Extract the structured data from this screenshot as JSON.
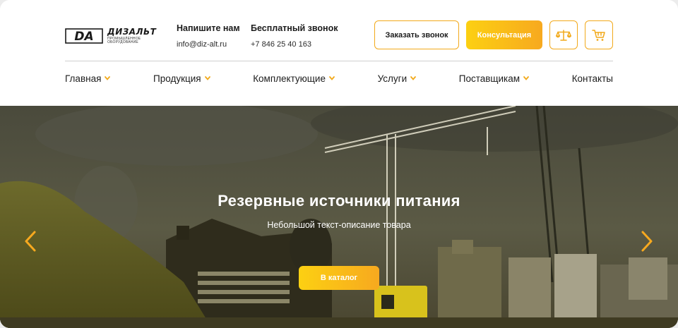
{
  "logo": {
    "mark": "DA",
    "name": "ДИЗАЛЬТ",
    "subtitle": "ПРОМЫШЛЕННОЕ ОБОРУДОВАНИЕ"
  },
  "contacts": {
    "email": {
      "title": "Напишите нам",
      "value": "info@diz-alt.ru"
    },
    "phone": {
      "title": "Бесплатный звонок",
      "value": "+7 846 25 40 163"
    }
  },
  "actions": {
    "callback_label": "Заказать звонок",
    "consult_label": "Консультация",
    "compare_icon": "scales-icon",
    "cart_icon": "cart-icon"
  },
  "nav": [
    {
      "label": "Главная",
      "dropdown": true
    },
    {
      "label": "Продукция",
      "dropdown": true
    },
    {
      "label": "Комплектующие",
      "dropdown": true
    },
    {
      "label": "Услуги",
      "dropdown": true
    },
    {
      "label": "Поставщикам",
      "dropdown": true
    },
    {
      "label": "Контакты",
      "dropdown": false
    }
  ],
  "hero": {
    "title": "Резервные источники питания",
    "subtitle": "Небольшой текст-описание товара",
    "cta_label": "В каталог"
  },
  "colors": {
    "accent": "#f7a91f",
    "accent_light": "#fcd012",
    "text": "#1c1c1c"
  }
}
